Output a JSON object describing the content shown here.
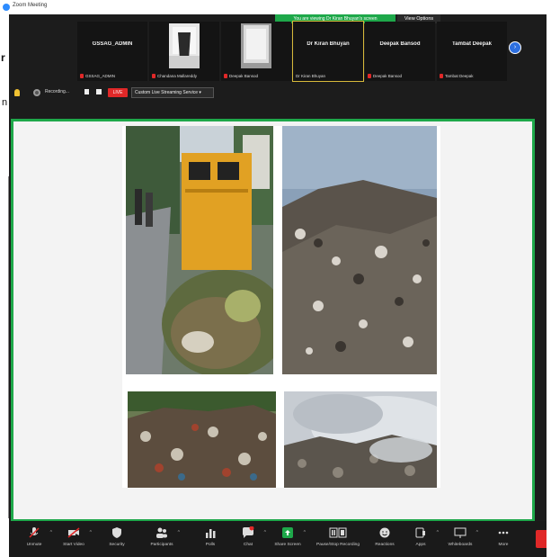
{
  "window": {
    "title": "Zoom Meeting"
  },
  "share_banner": {
    "text": "You are viewing Dr Kiran Bhuyan's screen",
    "view_options": "View Options"
  },
  "left_edge": {
    "glyph_r": "r",
    "glyph_n": "n"
  },
  "gallery": {
    "tiles": [
      {
        "name": "GSSAG_ADMIN",
        "label": "GSSAG_ADMIN",
        "has_photo": false
      },
      {
        "name": "",
        "label": "Chandana Mallareddy",
        "has_photo": true
      },
      {
        "name": "",
        "label": "Deepak Bansod",
        "has_photo": true
      },
      {
        "name": "Dr Kiran Bhuyan",
        "label": "Dr Kiran Bhuyan",
        "has_photo": false,
        "active": true
      },
      {
        "name": "Deepak Bansod",
        "label": "Deepak Bansod",
        "has_photo": false
      },
      {
        "name": "Tambat Deepak",
        "label": "Tambat Deepak",
        "has_photo": false
      }
    ],
    "next_icon": "chevron-right-icon"
  },
  "recording": {
    "status": "Recording...",
    "live_badge": "LIVE",
    "stream_label": "Custom Live Streaming Service"
  },
  "toolbar": {
    "items": [
      {
        "label": "Unmute",
        "icon": "microphone-muted-icon",
        "caret": true
      },
      {
        "label": "Start Video",
        "icon": "video-camera-off-icon",
        "caret": true
      },
      {
        "label": "Security",
        "icon": "shield-icon",
        "caret": false
      },
      {
        "label": "Participants",
        "icon": "participants-icon",
        "caret": true,
        "count": "12"
      },
      {
        "label": "Polls",
        "icon": "polls-icon",
        "caret": false
      },
      {
        "label": "Chat",
        "icon": "chat-icon",
        "caret": true
      },
      {
        "label": "Share Screen",
        "icon": "share-screen-icon",
        "caret": true
      },
      {
        "label": "Pause/Stop Recording",
        "icon": "pause-stop-recording-icon",
        "caret": false
      },
      {
        "label": "Reactions",
        "icon": "reactions-icon",
        "caret": false
      },
      {
        "label": "Apps",
        "icon": "apps-icon",
        "caret": true
      },
      {
        "label": "Whiteboards",
        "icon": "whiteboard-icon",
        "caret": true
      },
      {
        "label": "More",
        "icon": "more-icon",
        "caret": false
      }
    ]
  },
  "colors": {
    "share_border": "#1ea84a",
    "live_badge": "#e02828",
    "window_bg": "#1c1c1c",
    "active_speaker": "#d7b93a"
  }
}
